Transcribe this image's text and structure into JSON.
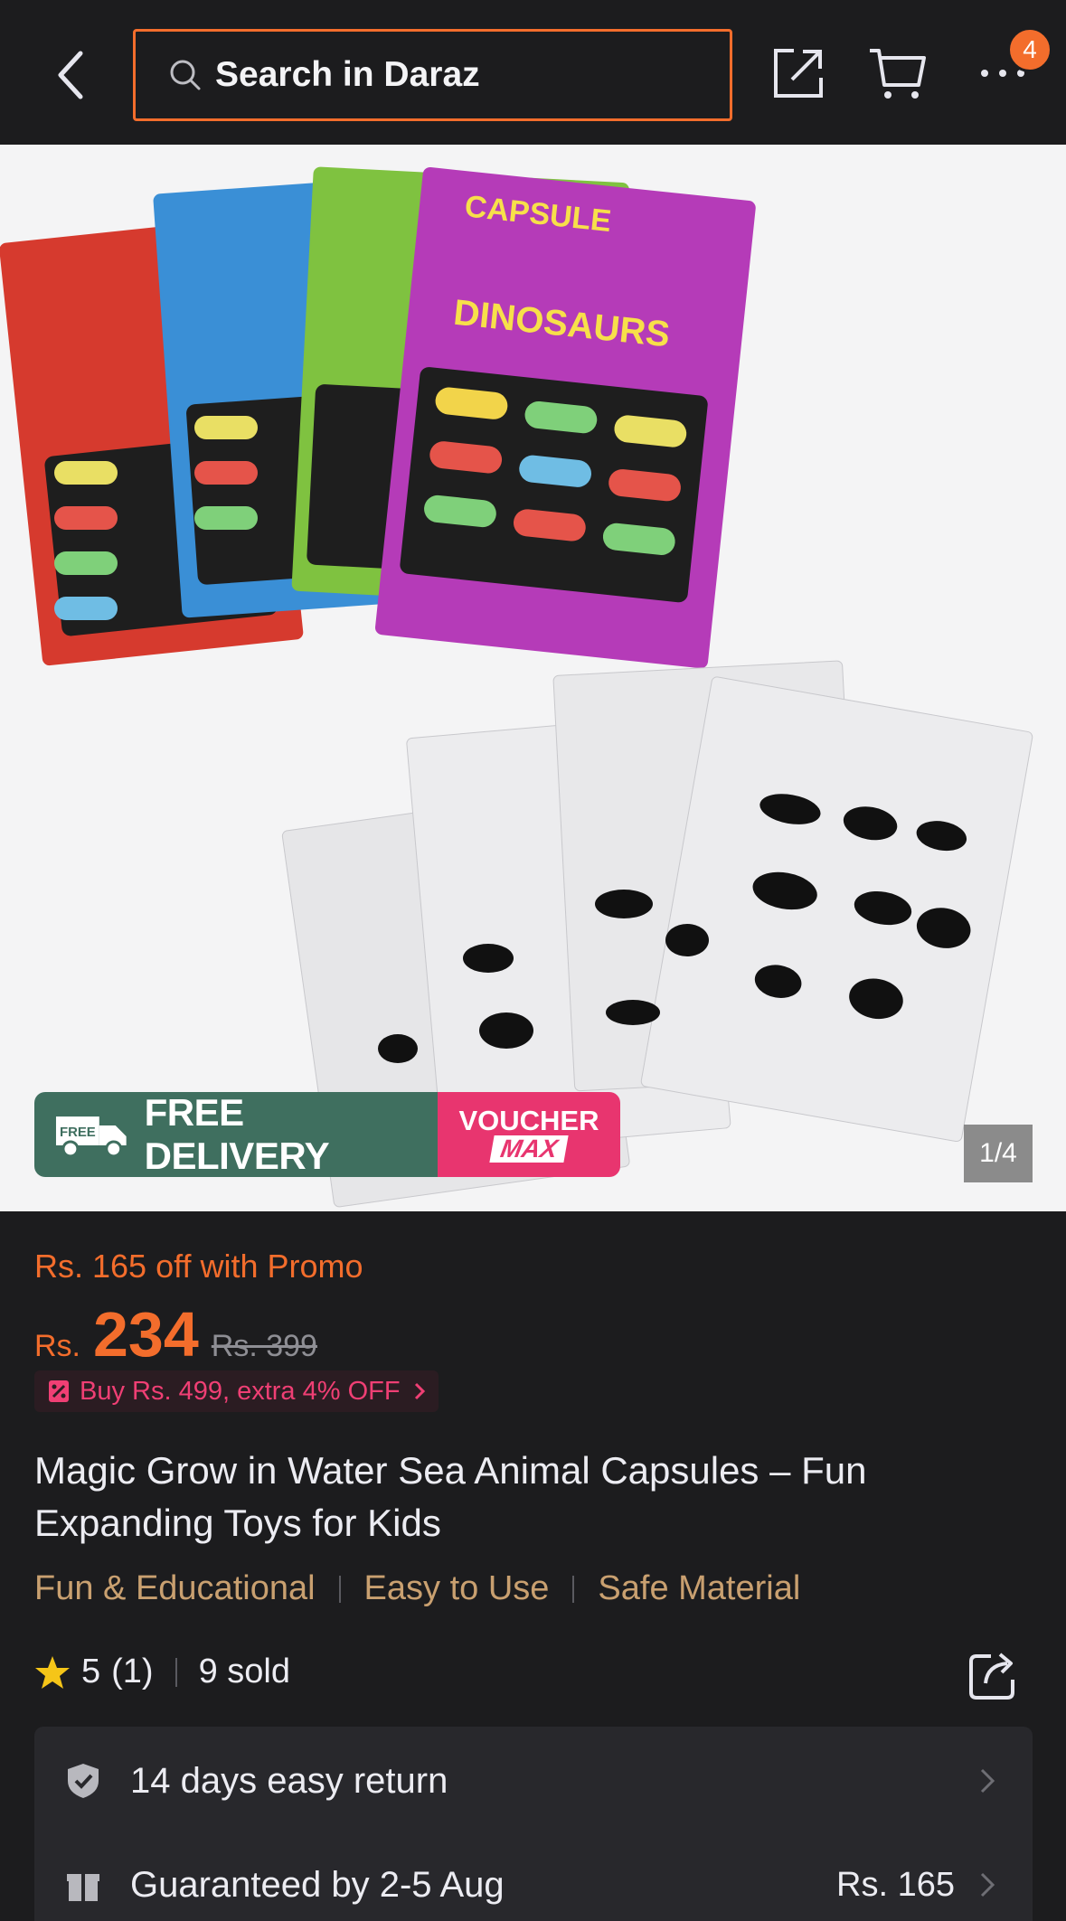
{
  "header": {
    "search_placeholder": "Search in Daraz",
    "cart_badge": "4"
  },
  "gallery": {
    "counter": "1/4",
    "delivery_label": "FREE DELIVERY",
    "delivery_tag": "FREE",
    "voucher_line1": "VOUCHER",
    "voucher_line2": "MAX"
  },
  "price": {
    "promo": "Rs. 165 off with Promo",
    "currency": "Rs.",
    "value": "234",
    "original": "Rs. 399",
    "bundle_offer": "Buy Rs. 499, extra 4% OFF"
  },
  "product": {
    "title": "Magic Grow in Water Sea Animal Capsules – Fun Expanding Toys for Kids",
    "tags": [
      "Fun & Educational",
      "Easy to Use",
      "Safe Material"
    ],
    "rating": "5",
    "rating_count": "(1)",
    "sold": "9 sold"
  },
  "services": [
    {
      "label": "14 days easy return",
      "value": ""
    },
    {
      "label": "Guaranteed by 2-5 Aug",
      "value": "Rs. 165"
    }
  ],
  "colors": {
    "accent": "#f36d2c",
    "background": "#1c1c1e",
    "pink": "#e8356f",
    "delivery_green": "#3f6f5f",
    "tag_gold": "#c9a070"
  }
}
